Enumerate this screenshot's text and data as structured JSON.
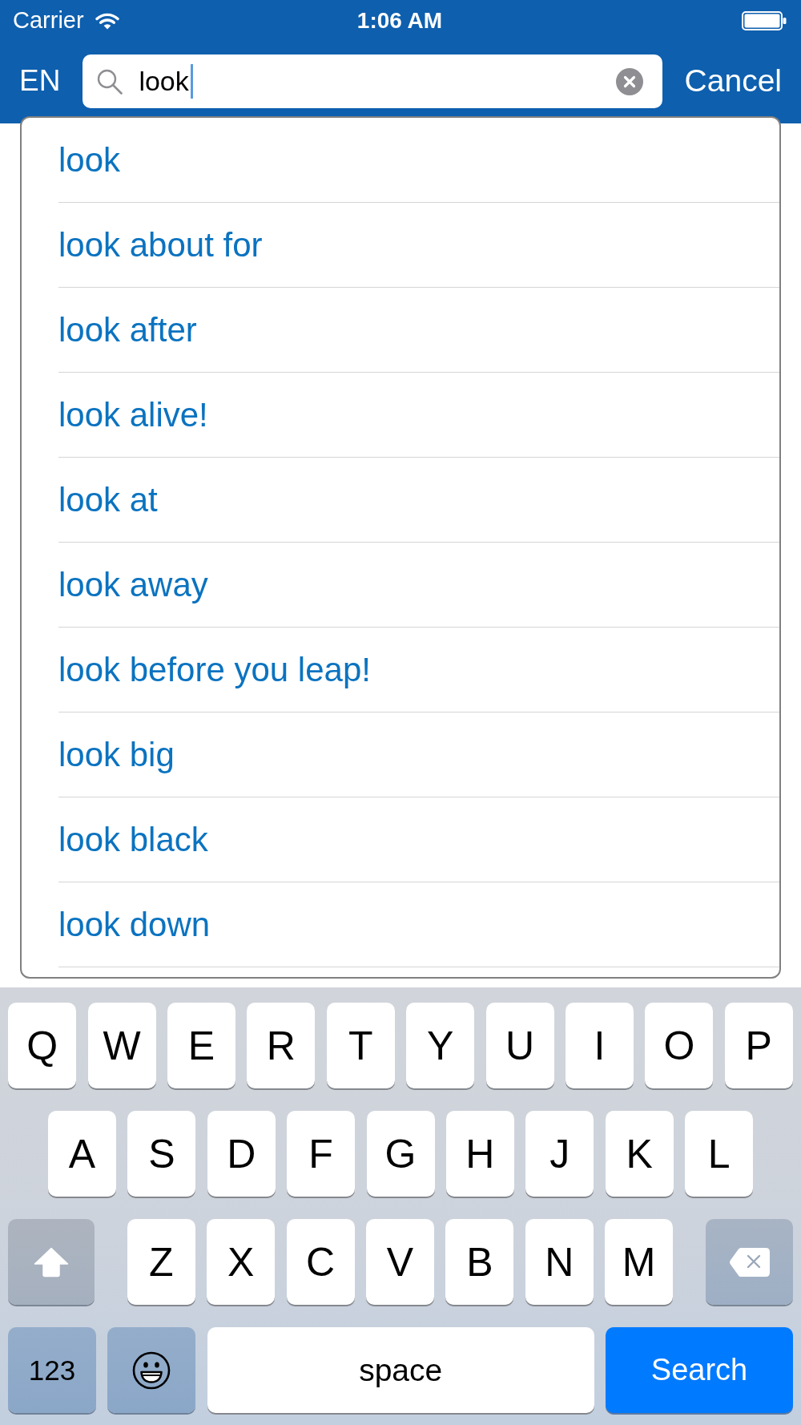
{
  "status_bar": {
    "carrier": "Carrier",
    "time": "1:06 AM"
  },
  "search_bar": {
    "language": "EN",
    "query": "look",
    "cancel": "Cancel"
  },
  "suggestions": [
    "look",
    "look about for",
    "look after",
    "look alive!",
    "look at",
    "look away",
    "look before you leap!",
    "look big",
    "look black",
    "look down"
  ],
  "keyboard": {
    "rows": [
      {
        "keys": [
          {
            "kind": "letter",
            "label": "Q"
          },
          {
            "kind": "letter",
            "label": "W"
          },
          {
            "kind": "letter",
            "label": "E"
          },
          {
            "kind": "letter",
            "label": "R"
          },
          {
            "kind": "letter",
            "label": "T"
          },
          {
            "kind": "letter",
            "label": "Y"
          },
          {
            "kind": "letter",
            "label": "U"
          },
          {
            "kind": "letter",
            "label": "I"
          },
          {
            "kind": "letter",
            "label": "O"
          },
          {
            "kind": "letter",
            "label": "P"
          }
        ]
      },
      {
        "keys": [
          {
            "kind": "letter",
            "label": "A"
          },
          {
            "kind": "letter",
            "label": "S"
          },
          {
            "kind": "letter",
            "label": "D"
          },
          {
            "kind": "letter",
            "label": "F"
          },
          {
            "kind": "letter",
            "label": "G"
          },
          {
            "kind": "letter",
            "label": "H"
          },
          {
            "kind": "letter",
            "label": "J"
          },
          {
            "kind": "letter",
            "label": "K"
          },
          {
            "kind": "letter",
            "label": "L"
          }
        ]
      },
      {
        "keys": [
          {
            "kind": "shift"
          },
          {
            "kind": "letter",
            "label": "Z"
          },
          {
            "kind": "letter",
            "label": "X"
          },
          {
            "kind": "letter",
            "label": "C"
          },
          {
            "kind": "letter",
            "label": "V"
          },
          {
            "kind": "letter",
            "label": "B"
          },
          {
            "kind": "letter",
            "label": "N"
          },
          {
            "kind": "letter",
            "label": "M"
          },
          {
            "kind": "delete"
          }
        ]
      },
      {
        "keys": [
          {
            "kind": "mode",
            "label": "123"
          },
          {
            "kind": "emoji"
          },
          {
            "kind": "space",
            "label": "space"
          },
          {
            "kind": "return",
            "label": "Search"
          }
        ]
      }
    ]
  }
}
